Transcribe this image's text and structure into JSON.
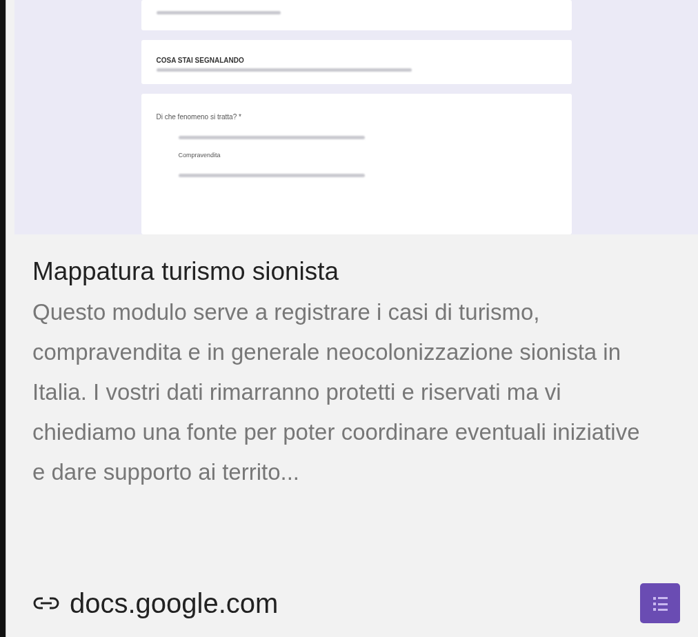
{
  "preview": {
    "sections": [
      {
        "kind": "footer"
      },
      {
        "kind": "header",
        "title": "COSA STAI SEGNALANDO"
      },
      {
        "kind": "question",
        "question": "Di che fenomeno si tratta? *",
        "options": [
          {
            "kind": "blurred"
          },
          {
            "kind": "text",
            "label": "Compravendita"
          },
          {
            "kind": "blurred"
          }
        ]
      }
    ]
  },
  "title": "Mappatura turismo sionista",
  "description": "Questo modulo serve a registrare i casi di turismo, compravendita e in generale neocolonizzazione sionista in Italia. I vostri dati rimarranno protetti e riservati ma vi chiediamo una fonte per poter coordinare eventuali iniziative e dare supporto ai territo...",
  "domain": "docs.google.com"
}
